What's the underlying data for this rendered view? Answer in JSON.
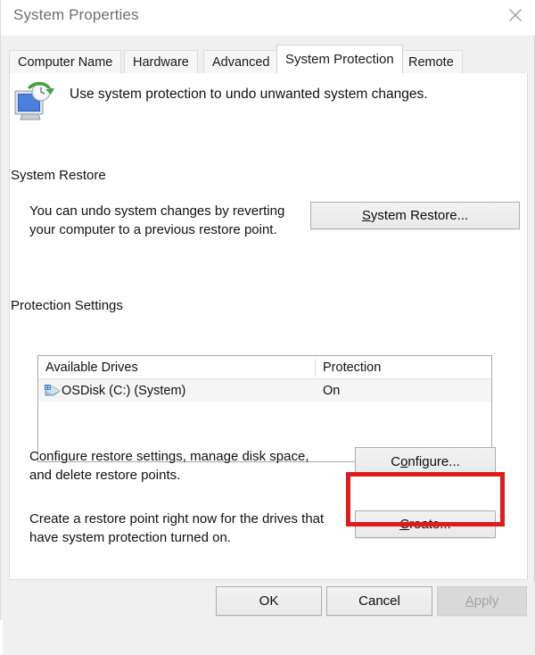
{
  "window": {
    "title": "System Properties",
    "close_icon": "close-icon"
  },
  "tabs": [
    {
      "label": "Computer Name",
      "active": false
    },
    {
      "label": "Hardware",
      "active": false
    },
    {
      "label": "Advanced",
      "active": false
    },
    {
      "label": "System Protection",
      "active": true
    },
    {
      "label": "Remote",
      "active": false
    }
  ],
  "header": {
    "icon": "system-protection-icon",
    "text": "Use system protection to undo unwanted system changes."
  },
  "system_restore": {
    "group_label": "System Restore",
    "description": "You can undo system changes by reverting\nyour computer to a previous restore point.",
    "button": {
      "accel": "S",
      "rest": "ystem Restore..."
    }
  },
  "protection_settings": {
    "group_label": "Protection Settings",
    "columns": [
      "Available Drives",
      "Protection"
    ],
    "rows": [
      {
        "icon": "hard-disk-icon",
        "drive": "OSDisk (C:) (System)",
        "protection": "On"
      }
    ],
    "configure_description": "Configure restore settings, manage disk space,\nand delete restore points.",
    "configure_button": {
      "pre": "C",
      "accel": "o",
      "rest": "nfigure..."
    },
    "create_description": "Create a restore point right now for the drives that\nhave system protection turned on.",
    "create_button": {
      "accel": "C",
      "rest": "reate..."
    }
  },
  "annotation": {
    "color": "#e01b1b",
    "target": "configure-button"
  },
  "footer": {
    "ok": "OK",
    "cancel": "Cancel",
    "apply": {
      "accel": "A",
      "rest": "pply",
      "disabled": true
    }
  }
}
